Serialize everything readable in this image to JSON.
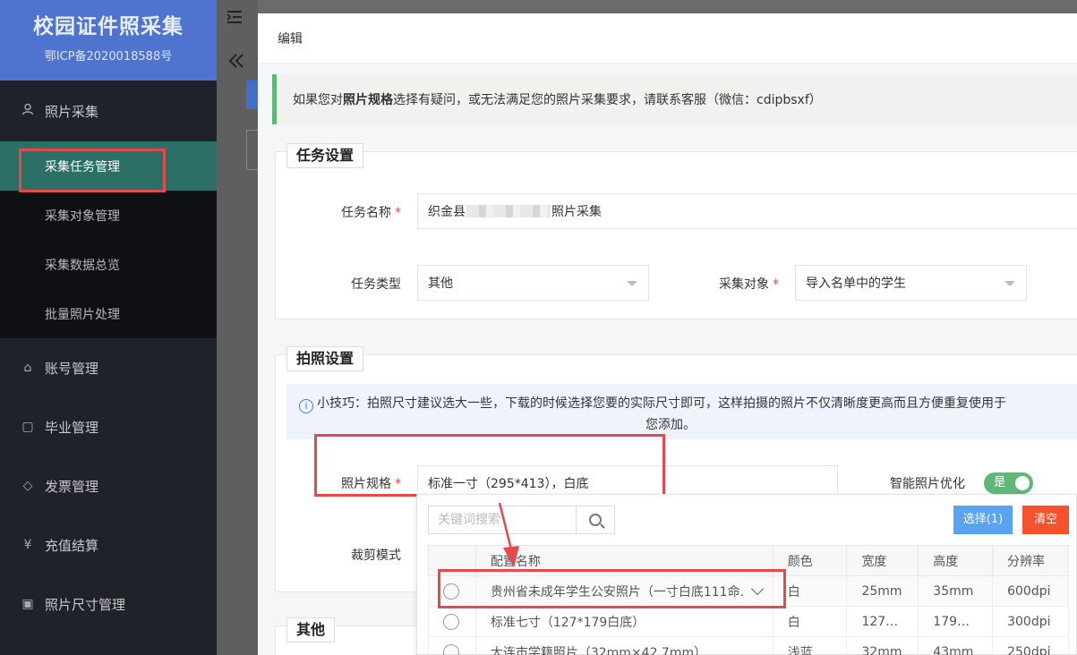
{
  "brand": {
    "title": "校园证件照采集",
    "icp": "鄂ICP备2020018588号"
  },
  "sidebar": {
    "group": {
      "label": "照片采集",
      "icon": "user-icon"
    },
    "subitems": [
      {
        "label": "采集任务管理",
        "active": true
      },
      {
        "label": "采集对象管理"
      },
      {
        "label": "采集数据总览"
      },
      {
        "label": "批量照片处理"
      }
    ],
    "items": [
      {
        "label": "账号管理",
        "icon": "home-icon",
        "glyph": "⌂"
      },
      {
        "label": "毕业管理",
        "icon": "document-icon",
        "glyph": "▢"
      },
      {
        "label": "发票管理",
        "icon": "tag-icon",
        "glyph": "◇"
      },
      {
        "label": "充值结算",
        "icon": "yen-icon",
        "glyph": "¥"
      },
      {
        "label": "照片尺寸管理",
        "icon": "image-icon",
        "glyph": "▣"
      }
    ]
  },
  "topbar": {
    "menu_toggle_icon": "indent-icon",
    "collapse_icon": "double-chevron-left-icon"
  },
  "modal": {
    "title": "编辑",
    "notice": {
      "prefix": "如果您对",
      "bold": "照片规格",
      "suffix": "选择有疑问，或无法满足您的照片采集要求，请联系客服（微信：cdipbsxf）"
    },
    "task_section": {
      "legend": "任务设置",
      "name_label": "任务名称",
      "name_prefix": "织金县",
      "name_suffix": "照片采集",
      "type_label": "任务类型",
      "type_value": "其他",
      "target_label": "采集对象",
      "target_value": "导入名单中的学生"
    },
    "photo_section": {
      "legend": "拍照设置",
      "tip_line1": "小技巧：拍照尺寸建议选大一些，下载的时候选择您要的实际尺寸即可，这样拍摄的照片不仅清晰度更高而且方便重复使用于",
      "tip_line2": "您添加。",
      "spec_label": "照片规格",
      "spec_value": "标准一寸（295*413），白底",
      "smart_label": "智能照片优化",
      "smart_value": "是",
      "crop_label": "裁剪模式"
    },
    "other_section": {
      "legend": "其他"
    }
  },
  "dropdown": {
    "search_placeholder": "关键词搜索",
    "select_label": "选择(1)",
    "clear_label": "清空",
    "columns": [
      "配置名称",
      "颜色",
      "宽度",
      "高度",
      "分辨率"
    ],
    "rows": [
      {
        "name": "贵州省未成年学生公安照片（一寸白底111命.",
        "color": "白",
        "width": "25mm",
        "height": "35mm",
        "dpi": "600dpi"
      },
      {
        "name": "标准七寸（127*179白底）",
        "color": "白",
        "width": "127…",
        "height": "179…",
        "dpi": "300dpi"
      },
      {
        "name": "大连市学籍照片（32mm×42.7mm）",
        "color": "浅蓝",
        "width": "32mm",
        "height": "43mm",
        "dpi": "250dpi"
      }
    ]
  },
  "colors": {
    "brand": "#4e74cf",
    "active": "#2b6f66",
    "accent_green": "#5fb878",
    "highlight_red": "#e5484d"
  }
}
